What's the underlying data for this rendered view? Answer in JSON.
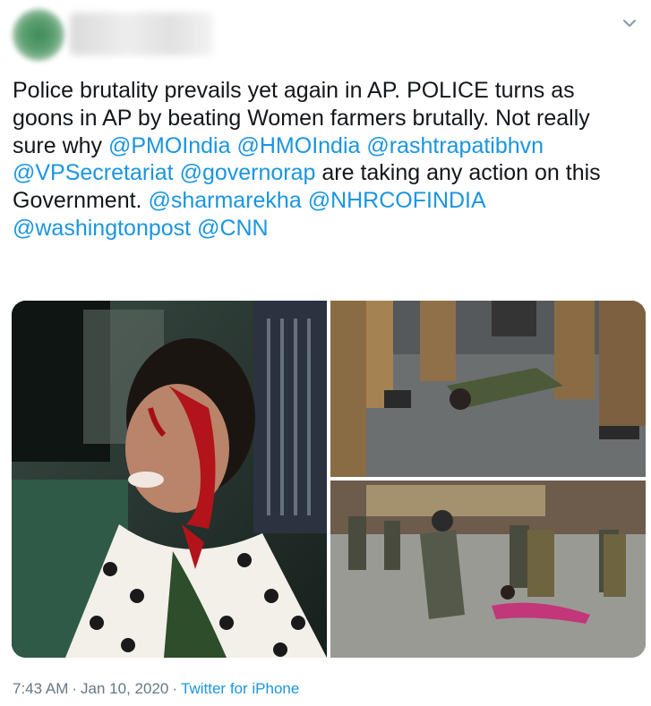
{
  "tweet": {
    "text_segments": [
      {
        "text": "Police brutality prevails yet again in AP. POLICE turns as goons in AP by beating Women farmers brutally. Not really sure why ",
        "mention": false
      },
      {
        "text": "@PMOIndia",
        "mention": true
      },
      {
        "text": " ",
        "mention": false
      },
      {
        "text": "@HMOIndia",
        "mention": true
      },
      {
        "text": " ",
        "mention": false
      },
      {
        "text": "@rashtrapatibhvn",
        "mention": true
      },
      {
        "text": " ",
        "mention": false
      },
      {
        "text": "@VPSecretariat",
        "mention": true
      },
      {
        "text": " ",
        "mention": false
      },
      {
        "text": "@governorap",
        "mention": true
      },
      {
        "text": " are taking any action on this Government. ",
        "mention": false
      },
      {
        "text": "@sharmarekha",
        "mention": true
      },
      {
        "text": " ",
        "mention": false
      },
      {
        "text": "@NHRCOFINDIA",
        "mention": true
      },
      {
        "text": " ",
        "mention": false
      },
      {
        "text": "@washingtonpost",
        "mention": true
      },
      {
        "text": " ",
        "mention": false
      },
      {
        "text": "@CNN",
        "mention": true
      }
    ]
  },
  "meta": {
    "time": "7:43 AM",
    "separator1": "·",
    "date": "Jan 10, 2020",
    "separator2": "·",
    "source": "Twitter for iPhone"
  },
  "colors": {
    "mention": "#1b95e0",
    "text": "#14171a",
    "meta": "#657786"
  },
  "icons": {
    "caret": "chevron-down-icon"
  }
}
